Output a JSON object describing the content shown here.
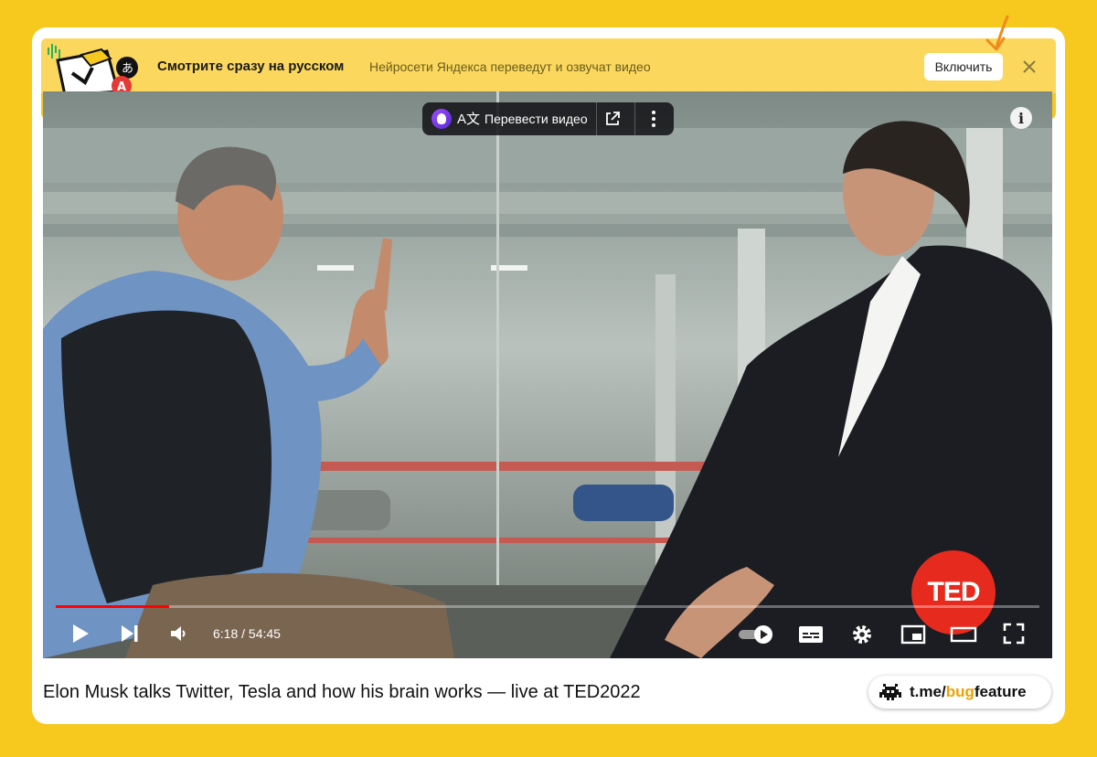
{
  "banner": {
    "title": "Смотрите сразу на русском",
    "subtitle": "Нейросети Яндекса переведут и озвучат видео",
    "enable_label": "Включить"
  },
  "translate_bar": {
    "label": "Перевести видео",
    "translate_icon_glyph": "A文"
  },
  "player": {
    "time": "6:18 / 54:45",
    "progress": 0.115,
    "ted_label": "TED"
  },
  "video": {
    "title": "Elon Musk talks Twitter, Tesla and how his brain works — live at TED2022"
  },
  "credit": {
    "prefix": "t.me/",
    "highlight": "bug",
    "suffix": "feature"
  },
  "colors": {
    "background": "#f7c81d",
    "banner": "#fbd85d",
    "progress": "#ff0000",
    "ted": "#e62b1e",
    "arrow": "#f08a1a",
    "highlight": "#f0a000"
  }
}
